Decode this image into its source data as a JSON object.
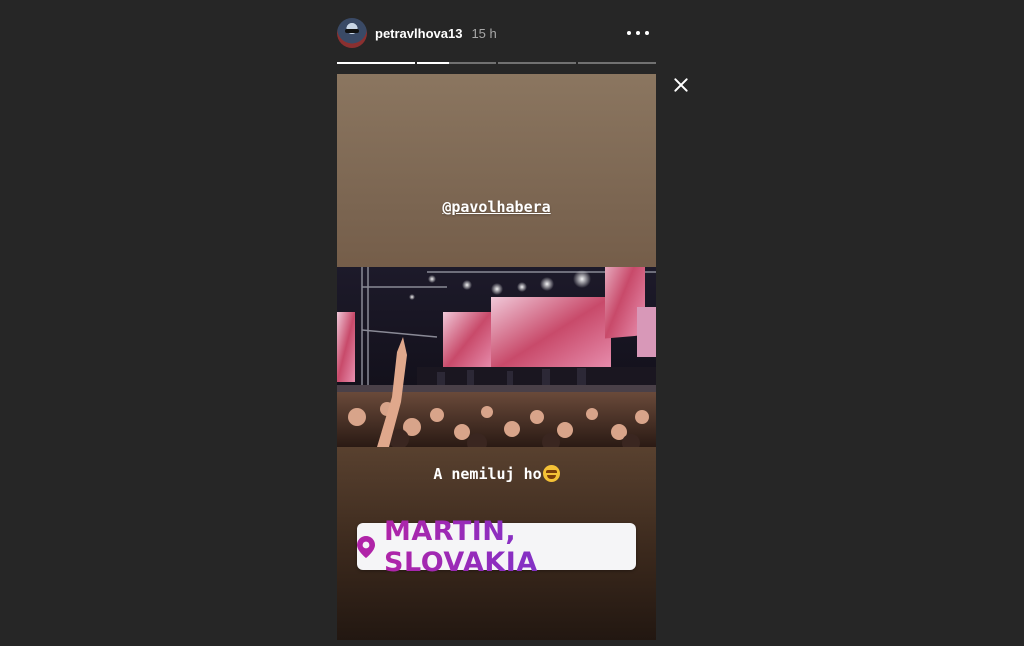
{
  "header": {
    "username": "petravlhova13",
    "time": "15 h"
  },
  "progress": {
    "segments": 4,
    "current_index": 1,
    "current_fraction": 0.4
  },
  "story": {
    "mention": "@pavolhabera",
    "caption": "A nemiluj ho",
    "location": "MARTIN, SLOVAKIA"
  },
  "icons": {
    "more": "more-dots-icon",
    "close": "close-icon",
    "location": "location-pin-icon"
  },
  "colors": {
    "background": "#262626",
    "location_gradient_start": "#b024a8",
    "location_gradient_end": "#6a3bd0"
  }
}
